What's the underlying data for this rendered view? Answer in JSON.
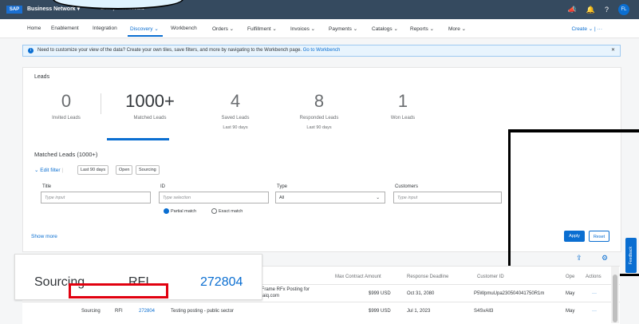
{
  "header": {
    "logo": "SAP",
    "brand": "Business Network ▾",
    "account": "Enterprise Account",
    "avatar": "FL"
  },
  "nav": {
    "items": [
      "Home",
      "Enablement",
      "Integration",
      "Discovery ⌄",
      "Workbench",
      "Orders ⌄",
      "Fulfillment ⌄",
      "Invoices ⌄",
      "Payments ⌄",
      "Catalogs ⌄",
      "Reports ⌄",
      "More ⌄"
    ],
    "create": "Create ⌄  |  ···"
  },
  "info": {
    "text": "Need to customize your view of the data? Create your own tiles, save filters, and more by navigating to the Workbench page.",
    "link": "Go to Workbench",
    "close": "✕"
  },
  "leads": {
    "title": "Leads",
    "stats": [
      {
        "num": "0",
        "label": "Invited Leads",
        "sub": ""
      },
      {
        "num": "1000+",
        "label": "Matched Leads",
        "sub": ""
      },
      {
        "num": "4",
        "label": "Saved Leads",
        "sub": "Last 90 days"
      },
      {
        "num": "8",
        "label": "Responded Leads",
        "sub": "Last 90 days"
      },
      {
        "num": "1",
        "label": "Won Leads",
        "sub": ""
      }
    ]
  },
  "filter": {
    "matched": "Matched Leads (1000+)",
    "edit": "⌄ Edit filter",
    "sep": "|",
    "chips": [
      "Last 90 days",
      "Open",
      "Sourcing"
    ],
    "fields": [
      {
        "label": "Title",
        "placeholder": "Type input"
      },
      {
        "label": "ID",
        "placeholder": "Type selection"
      },
      {
        "label": "Type",
        "value": "All"
      },
      {
        "label": "Customers",
        "placeholder": "Type input"
      }
    ],
    "partial": "Partial match",
    "exact": "Exact match",
    "show_more": "Show more",
    "apply": "Apply",
    "reset": "Reset"
  },
  "feedback": "Feedback",
  "table": {
    "headers": [
      "Max Contract Amount",
      "Response Deadline",
      "Customer ID",
      "Ope",
      "Actions"
    ],
    "rows": [
      {
        "title": "IFrame RFx Posting for",
        "title2": "saiq.com",
        "amount": "$999 USD",
        "deadline": "Oct 31, 2080",
        "cust": "P5WpmuUpa230504041750R1m",
        "ope": "May",
        "actions": "···"
      },
      {
        "type": "Sourcing",
        "rfx": "RFI",
        "id": "272804",
        "title": "Testing posting - public sector",
        "amount": "$999 USD",
        "deadline": "Jul 1, 2023",
        "cust": "S4SvAll3",
        "ope": "May",
        "actions": "···"
      }
    ]
  },
  "zoom": {
    "type": "Sourcing",
    "rfx": "RFI",
    "id": "272804"
  }
}
